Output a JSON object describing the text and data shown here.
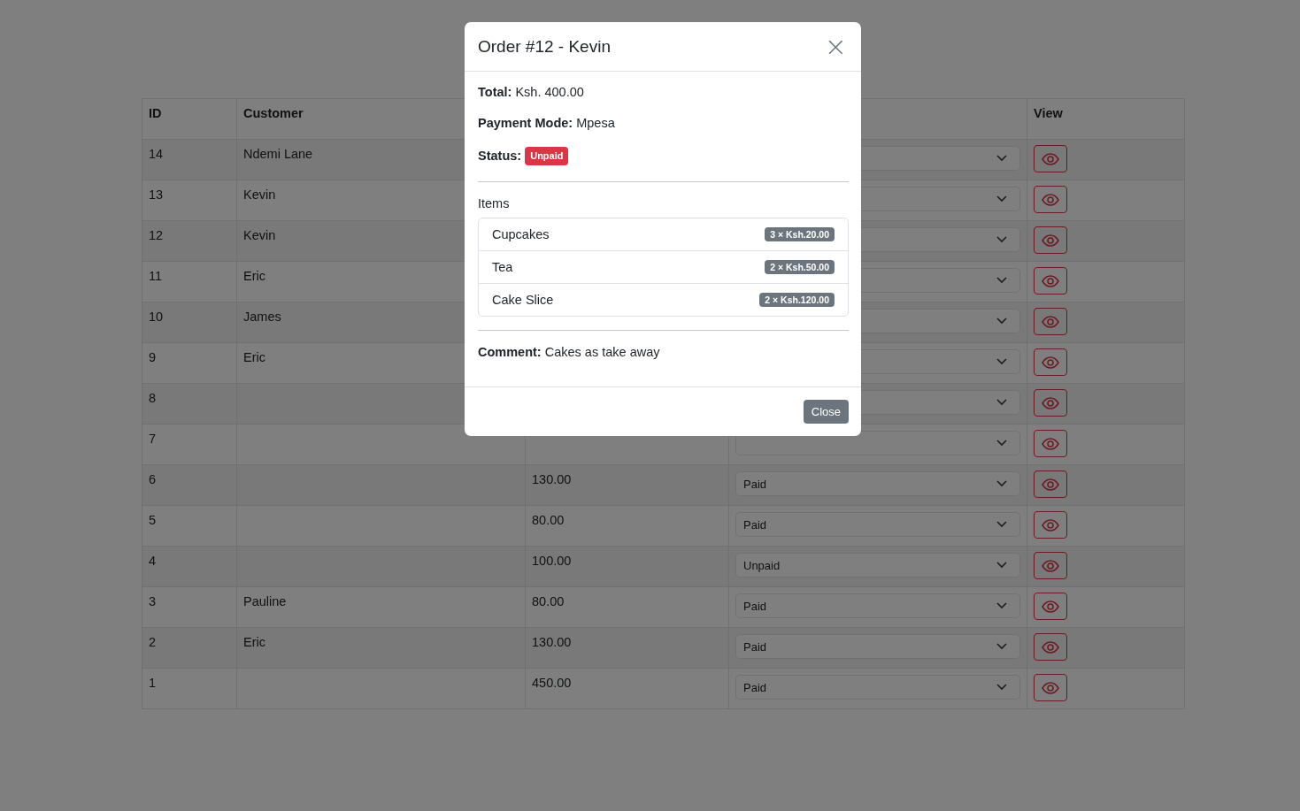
{
  "table": {
    "columns": [
      "ID",
      "Customer",
      "View"
    ],
    "rows": [
      {
        "id": "14",
        "customer": "Ndemi Lane"
      },
      {
        "id": "13",
        "customer": "Kevin"
      },
      {
        "id": "12",
        "customer": "Kevin"
      },
      {
        "id": "11",
        "customer": "Eric"
      },
      {
        "id": "10",
        "customer": "James"
      },
      {
        "id": "9",
        "customer": "Eric"
      },
      {
        "id": "8",
        "customer": ""
      },
      {
        "id": "7",
        "customer": ""
      },
      {
        "id": "6",
        "customer": "",
        "amount": "130.00",
        "status": "Paid"
      },
      {
        "id": "5",
        "customer": "",
        "amount": "80.00",
        "status": "Paid"
      },
      {
        "id": "4",
        "customer": "",
        "amount": "100.00",
        "status": "Unpaid"
      },
      {
        "id": "3",
        "customer": "Pauline",
        "amount": "80.00",
        "status": "Paid"
      },
      {
        "id": "2",
        "customer": "Eric",
        "amount": "130.00",
        "status": "Paid"
      },
      {
        "id": "1",
        "customer": "",
        "amount": "450.00",
        "status": "Paid"
      }
    ]
  },
  "modal": {
    "title": "Order #12 - Kevin",
    "close_icon": "×",
    "fields": [
      {
        "label": "Total:",
        "value": "Ksh. 400.00"
      },
      {
        "label": "Payment Mode:",
        "value": "Mpesa"
      }
    ],
    "status": {
      "label": "Status:",
      "badge": "Unpaid",
      "kind": "unpaid"
    },
    "items_heading": "Items",
    "items": [
      {
        "name": "Cupcakes",
        "qty": "3 × Ksh.20.00"
      },
      {
        "name": "Tea",
        "qty": "2 × Ksh.50.00"
      },
      {
        "name": "Cake Slice",
        "qty": "2 × Ksh.120.00"
      }
    ],
    "comment": {
      "label": "Comment:",
      "value": "Cakes as take away"
    },
    "footer_button": "Close"
  }
}
